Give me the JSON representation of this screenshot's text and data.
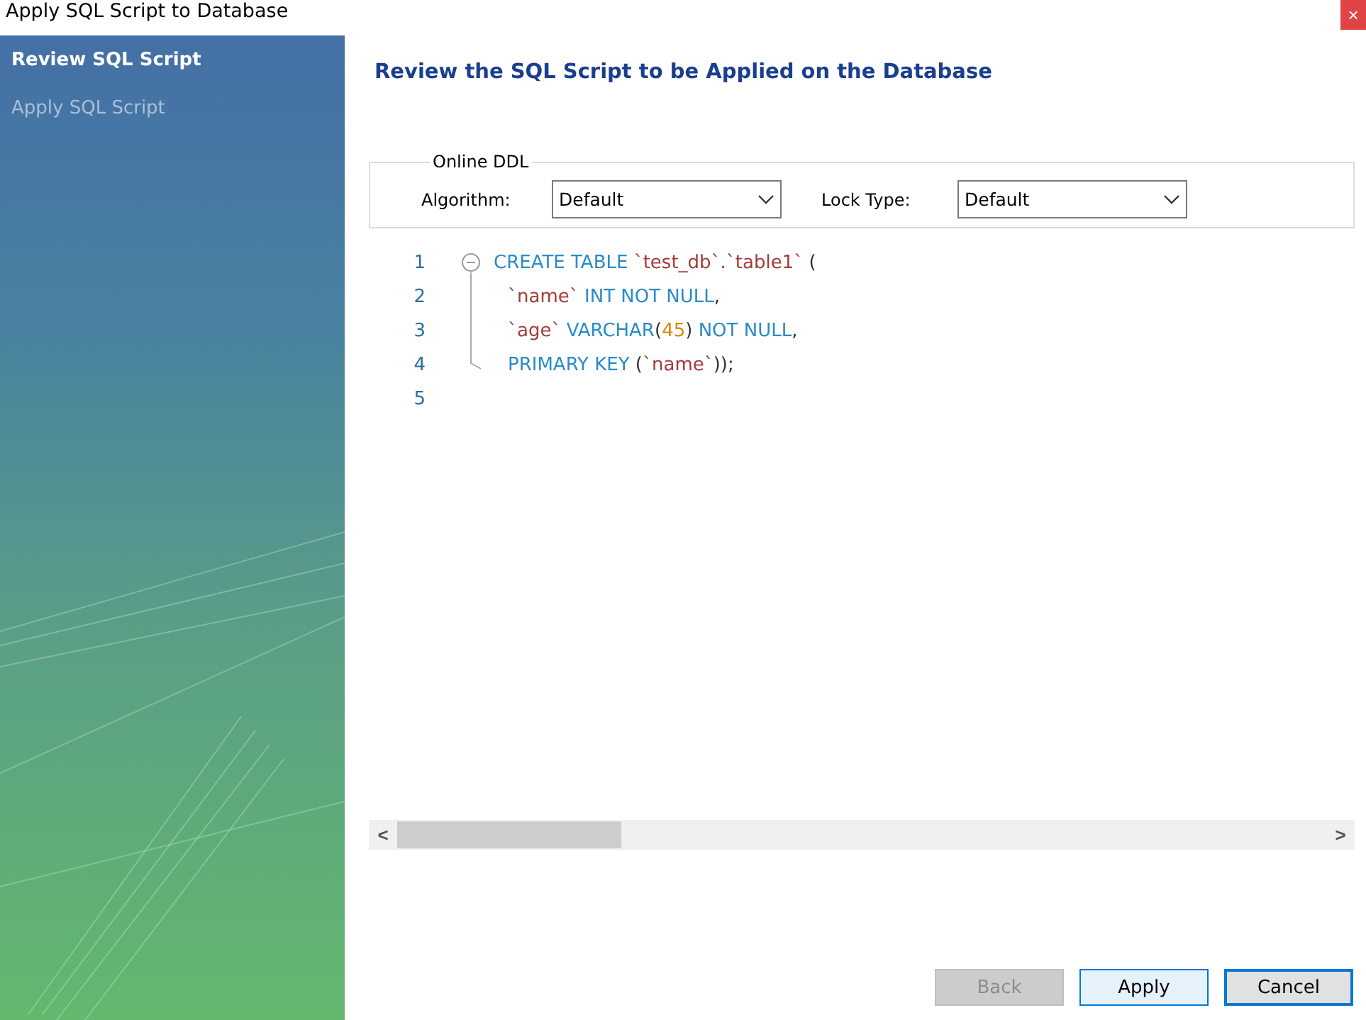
{
  "window": {
    "title": "Apply SQL Script to Database",
    "close": "×"
  },
  "sidebar": {
    "items": [
      {
        "label": "Review SQL Script",
        "selected": true
      },
      {
        "label": "Apply SQL Script",
        "selected": false
      }
    ]
  },
  "heading": "Review the SQL Script to be Applied on the Database",
  "online_ddl": {
    "title": "Online DDL",
    "fields": [
      {
        "label": "Algorithm:",
        "value": "Default"
      },
      {
        "label": "Lock Type:",
        "value": "Default"
      }
    ]
  },
  "editor": {
    "lines": [
      {
        "number": "1",
        "indented": false,
        "tokens": [
          {
            "kind": "keyword",
            "text": "CREATE TABLE "
          },
          {
            "kind": "identifier",
            "text": "`test_db`.`table1`"
          },
          {
            "kind": "punct",
            "text": " ("
          }
        ]
      },
      {
        "number": "2",
        "indented": true,
        "tokens": [
          {
            "kind": "identifier",
            "text": "`name`"
          },
          {
            "kind": "keyword",
            "text": " INT NOT NULL"
          },
          {
            "kind": "punct",
            "text": ","
          }
        ]
      },
      {
        "number": "3",
        "indented": true,
        "tokens": [
          {
            "kind": "identifier",
            "text": "`age`"
          },
          {
            "kind": "keyword",
            "text": " VARCHAR"
          },
          {
            "kind": "punct",
            "text": "("
          },
          {
            "kind": "number",
            "text": "45"
          },
          {
            "kind": "punct",
            "text": ")"
          },
          {
            "kind": "keyword",
            "text": " NOT NULL"
          },
          {
            "kind": "punct",
            "text": ","
          }
        ]
      },
      {
        "number": "4",
        "indented": true,
        "tokens": [
          {
            "kind": "keyword",
            "text": "PRIMARY KEY "
          },
          {
            "kind": "punct",
            "text": "("
          },
          {
            "kind": "identifier",
            "text": "`name`"
          },
          {
            "kind": "punct",
            "text": "));"
          }
        ]
      },
      {
        "number": "5",
        "indented": false
      }
    ]
  },
  "scrollbar": {
    "left": "<",
    "right": ">"
  },
  "buttons": [
    {
      "label": "Back",
      "disabled": true,
      "focused": false,
      "hover": false
    },
    {
      "label": "Apply",
      "disabled": false,
      "focused": false,
      "hover": true
    },
    {
      "label": "Cancel",
      "disabled": false,
      "focused": true,
      "hover": false
    }
  ]
}
